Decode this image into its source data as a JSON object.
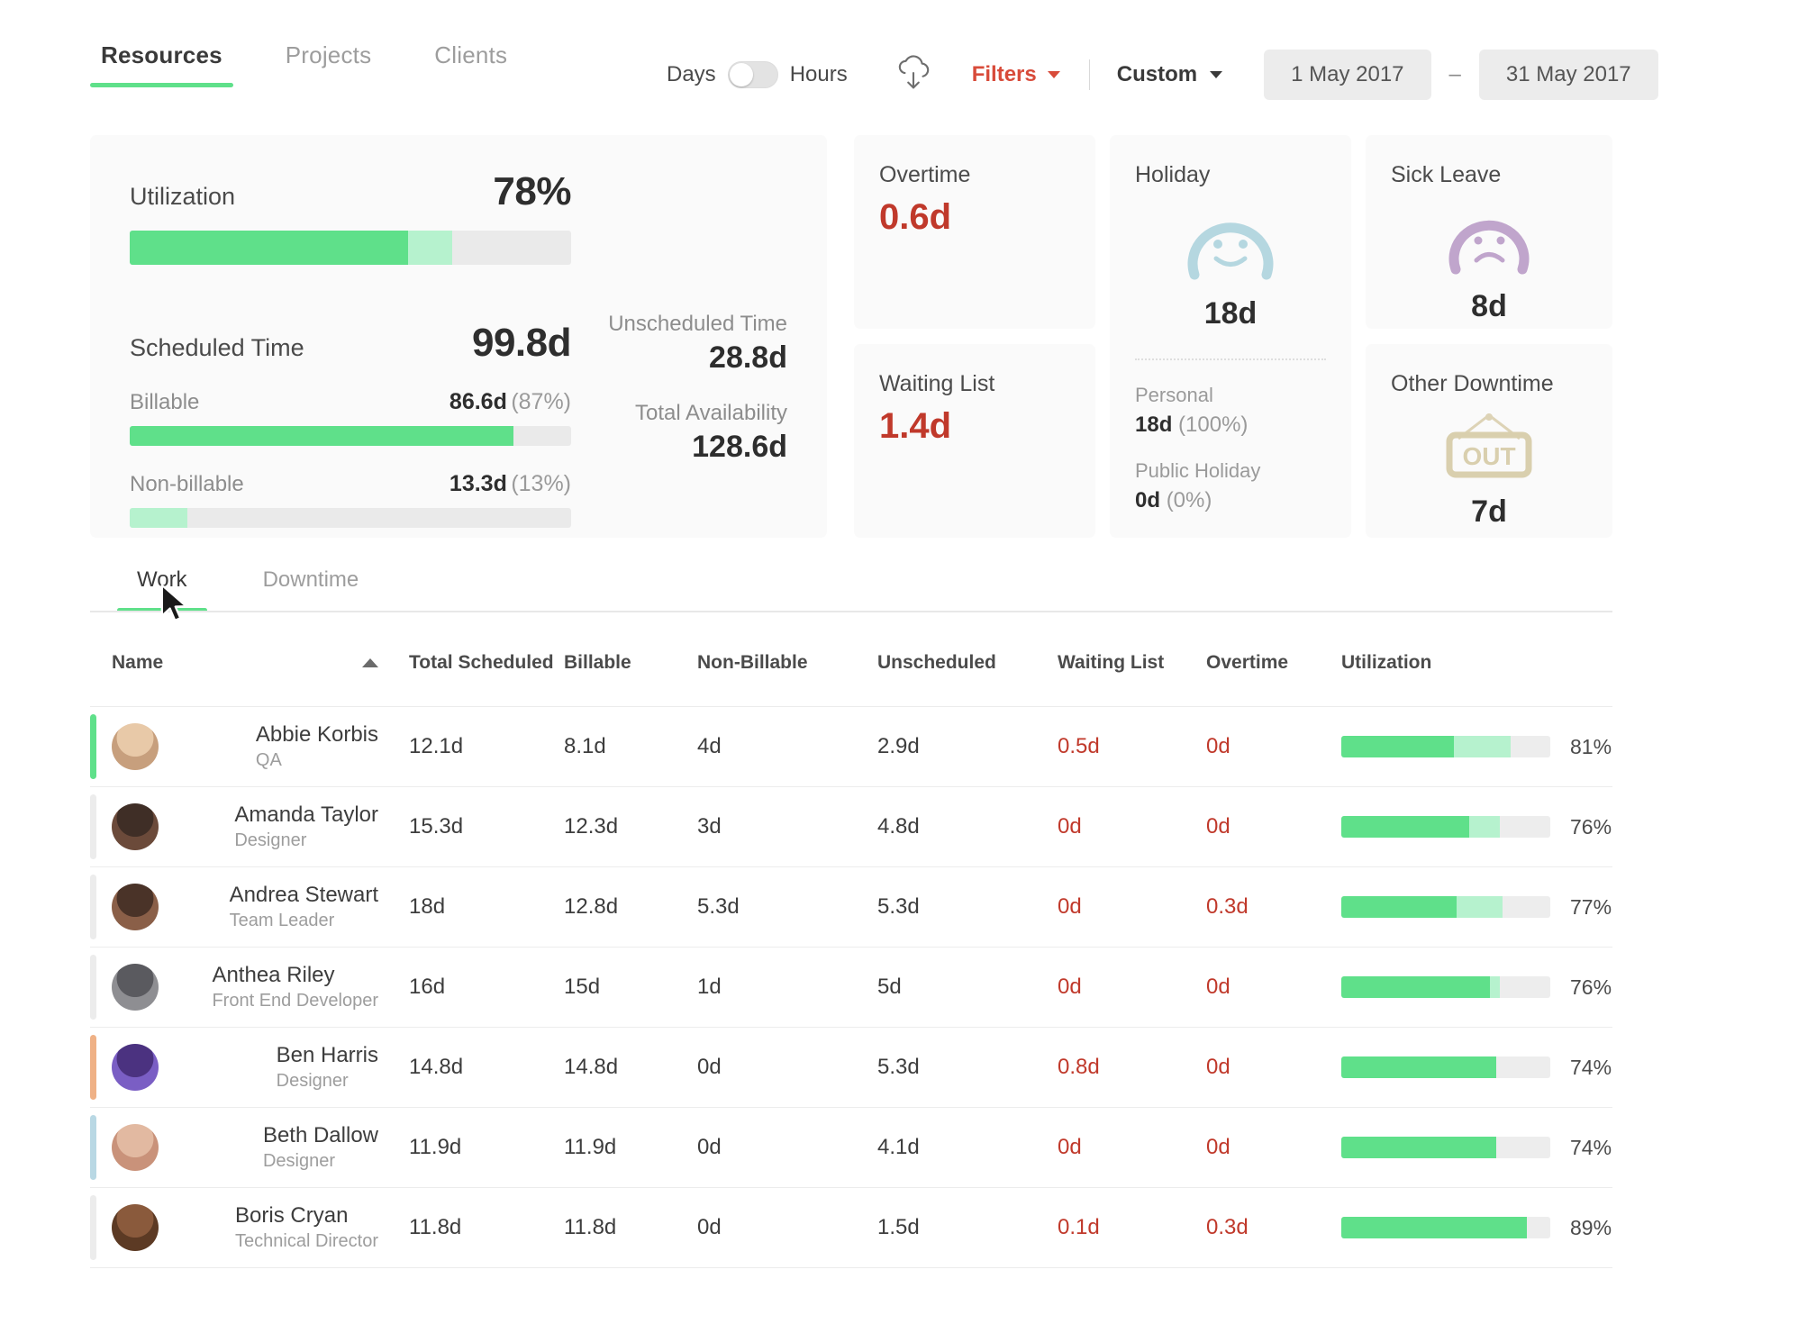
{
  "header": {
    "tabs": [
      {
        "label": "Resources",
        "active": true
      },
      {
        "label": "Projects",
        "active": false
      },
      {
        "label": "Clients",
        "active": false
      }
    ],
    "unit_toggle": {
      "left_label": "Days",
      "right_label": "Hours",
      "selected": "Days"
    },
    "download_icon": "cloud-download-icon",
    "filters_label": "Filters",
    "range_preset_label": "Custom",
    "date_from": "1 May 2017",
    "date_separator": "–",
    "date_to": "31 May 2017"
  },
  "summary": {
    "utilization": {
      "label": "Utilization",
      "value": "78%",
      "billable_pct": 63,
      "nonbillable_pct": 10
    },
    "scheduled": {
      "label": "Scheduled Time",
      "value": "99.8d",
      "billable": {
        "label": "Billable",
        "value": "86.6d",
        "pct_text": "(87%)",
        "pct": 87
      },
      "nonbillable": {
        "label": "Non-billable",
        "value": "13.3d",
        "pct_text": "(13%)",
        "pct": 13
      }
    },
    "unscheduled": {
      "label": "Unscheduled Time",
      "value": "28.8d"
    },
    "availability": {
      "label": "Total Availability",
      "value": "128.6d"
    },
    "overtime": {
      "label": "Overtime",
      "value": "0.6d"
    },
    "waiting_list": {
      "label": "Waiting List",
      "value": "1.4d"
    },
    "holiday": {
      "label": "Holiday",
      "icon": "happy-face-icon",
      "value": "18d",
      "personal": {
        "label": "Personal",
        "value": "18d",
        "pct_text": "(100%)"
      },
      "public": {
        "label": "Public Holiday",
        "value": "0d",
        "pct_text": "(0%)"
      }
    },
    "sick_leave": {
      "label": "Sick Leave",
      "icon": "sad-face-icon",
      "value": "8d"
    },
    "other_downtime": {
      "label": "Other Downtime",
      "icon": "out-sign-icon",
      "icon_text": "OUT",
      "value": "7d"
    }
  },
  "table": {
    "tabs": [
      {
        "label": "Work",
        "active": true
      },
      {
        "label": "Downtime",
        "active": false
      }
    ],
    "columns": [
      "Name",
      "Total Scheduled",
      "Billable",
      "Non-Billable",
      "Unscheduled",
      "Waiting List",
      "Overtime",
      "Utilization"
    ],
    "sort": {
      "column": "Name",
      "direction": "asc"
    },
    "rows": [
      {
        "name": "Abbie Korbis",
        "role": "QA",
        "accent": "#5fe08a",
        "avatar_colors": [
          "#e8c9a8",
          "#c79f7d"
        ],
        "total_scheduled": "12.1d",
        "billable": "8.1d",
        "non_billable": "4d",
        "unscheduled": "2.9d",
        "waiting_list": "0.5d",
        "overtime": "0d",
        "utilization": "81%",
        "bar_billable": 54,
        "bar_nonbillable": 27
      },
      {
        "name": "Amanda Taylor",
        "role": "Designer",
        "accent": "#ececec",
        "avatar_colors": [
          "#3f2e26",
          "#6b4a3a"
        ],
        "total_scheduled": "15.3d",
        "billable": "12.3d",
        "non_billable": "3d",
        "unscheduled": "4.8d",
        "waiting_list": "0d",
        "overtime": "0d",
        "utilization": "76%",
        "bar_billable": 61,
        "bar_nonbillable": 15
      },
      {
        "name": "Andrea Stewart",
        "role": "Team Leader",
        "accent": "#ececec",
        "avatar_colors": [
          "#4a3328",
          "#8a5f48"
        ],
        "total_scheduled": "18d",
        "billable": "12.8d",
        "non_billable": "5.3d",
        "unscheduled": "5.3d",
        "waiting_list": "0d",
        "overtime": "0.3d",
        "utilization": "77%",
        "bar_billable": 55,
        "bar_nonbillable": 22
      },
      {
        "name": "Anthea Riley",
        "role": "Front End Developer",
        "accent": "#ececec",
        "avatar_colors": [
          "#5a5a5f",
          "#8e8e92"
        ],
        "total_scheduled": "16d",
        "billable": "15d",
        "non_billable": "1d",
        "unscheduled": "5d",
        "waiting_list": "0d",
        "overtime": "0d",
        "utilization": "76%",
        "bar_billable": 71,
        "bar_nonbillable": 5
      },
      {
        "name": "Ben Harris",
        "role": "Designer",
        "accent": "#efb186",
        "avatar_colors": [
          "#4b3280",
          "#7a5ec4"
        ],
        "total_scheduled": "14.8d",
        "billable": "14.8d",
        "non_billable": "0d",
        "unscheduled": "5.3d",
        "waiting_list": "0.8d",
        "overtime": "0d",
        "utilization": "74%",
        "bar_billable": 74,
        "bar_nonbillable": 0
      },
      {
        "name": "Beth Dallow",
        "role": "Designer",
        "accent": "#b9d8e4",
        "avatar_colors": [
          "#e2b9a1",
          "#c9927a"
        ],
        "total_scheduled": "11.9d",
        "billable": "11.9d",
        "non_billable": "0d",
        "unscheduled": "4.1d",
        "waiting_list": "0d",
        "overtime": "0d",
        "utilization": "74%",
        "bar_billable": 74,
        "bar_nonbillable": 0
      },
      {
        "name": "Boris Cryan",
        "role": "Technical Director",
        "accent": "#ececec",
        "avatar_colors": [
          "#8a5a3c",
          "#5c3a24"
        ],
        "total_scheduled": "11.8d",
        "billable": "11.8d",
        "non_billable": "0d",
        "unscheduled": "1.5d",
        "waiting_list": "0.1d",
        "overtime": "0.3d",
        "utilization": "89%",
        "bar_billable": 89,
        "bar_nonbillable": 0
      }
    ]
  },
  "colors": {
    "accent_green": "#5fe08a",
    "accent_green_light": "#b6f2ce",
    "danger_red": "#c0392b",
    "filters_red": "#d84b3a",
    "holiday_blue": "#b5d7e0",
    "sick_purple": "#c0a5cc",
    "out_beige": "#d9cfae"
  }
}
